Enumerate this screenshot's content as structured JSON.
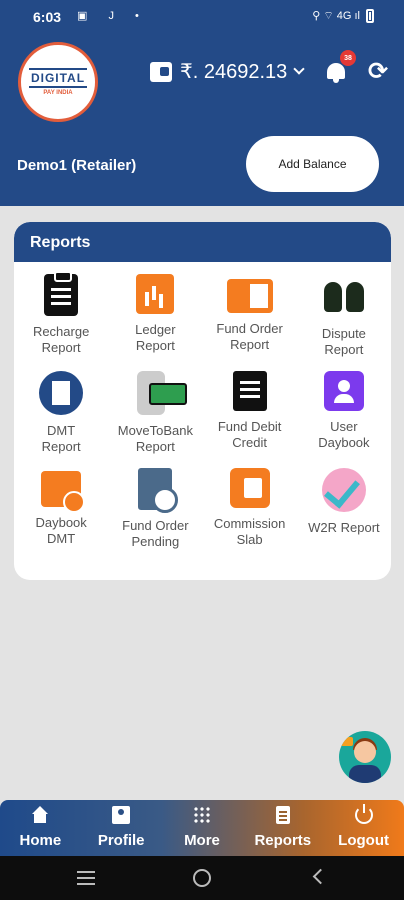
{
  "status_bar": {
    "time": "6:03",
    "left_icons": "▣ J •",
    "right_icons": "⚲ ⌔ 4G ıl"
  },
  "header": {
    "logo_line1": "DIGITAL",
    "logo_line2": "PAY INDIA",
    "wallet_amount": "₹. 24692.13",
    "notification_count": "38",
    "user_name": "Demo1 (Retailer)",
    "add_balance_label": "Add Balance"
  },
  "reports": {
    "title": "Reports",
    "items": [
      {
        "label": "Recharge\nReport",
        "icon": "clipboard-icon"
      },
      {
        "label": "Ledger\nReport",
        "icon": "bar-chart-icon"
      },
      {
        "label": "Fund Order\nReport",
        "icon": "fund-order-icon"
      },
      {
        "label": "Dispute\nReport",
        "icon": "dispute-icon"
      },
      {
        "label": "DMT\nReport",
        "icon": "document-icon"
      },
      {
        "label": "MoveToBank\nReport",
        "icon": "phone-money-icon"
      },
      {
        "label": "Fund Debit\nCredit",
        "icon": "receipt-icon"
      },
      {
        "label": "User\nDaybook",
        "icon": "user-card-icon"
      },
      {
        "label": "Daybook\nDMT",
        "icon": "calendar-rupee-icon"
      },
      {
        "label": "Fund Order\nPending",
        "icon": "pending-doc-icon"
      },
      {
        "label": "Commission\nSlab",
        "icon": "wallet-icon"
      },
      {
        "label": "W2R Report",
        "icon": "check-cross-icon"
      }
    ]
  },
  "bottom_nav": {
    "home": "Home",
    "profile": "Profile",
    "more": "More",
    "reports": "Reports",
    "logout": "Logout"
  },
  "colors": {
    "primary": "#234a87",
    "accent": "#f47c20",
    "badge": "#e53935"
  }
}
